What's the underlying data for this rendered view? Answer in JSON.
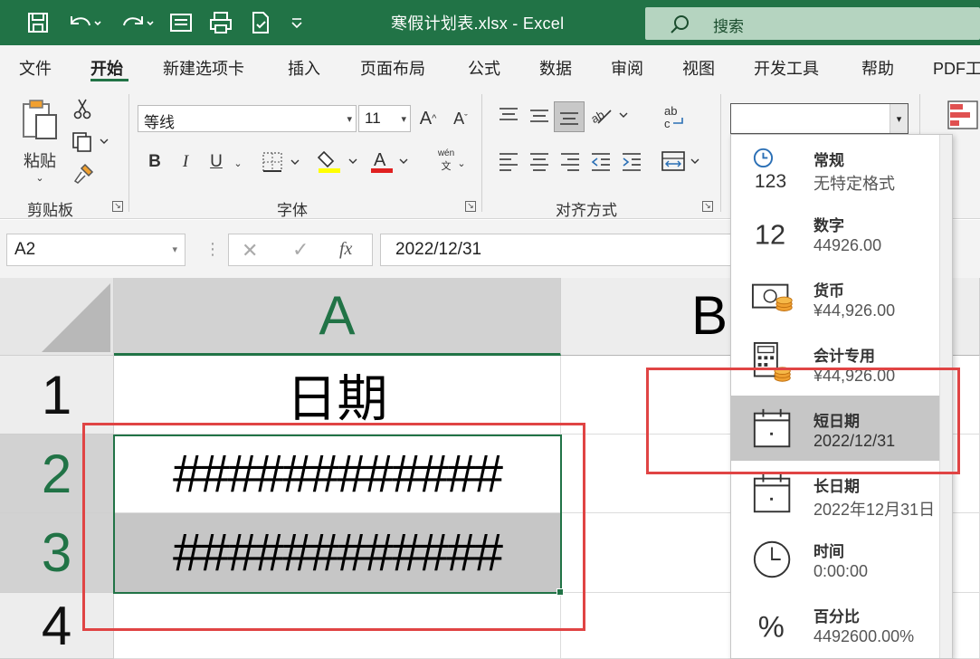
{
  "window": {
    "title": "寒假计划表.xlsx  -  Excel",
    "search_placeholder": "搜索"
  },
  "tabs": [
    "文件",
    "开始",
    "新建选项卡",
    "插入",
    "页面布局",
    "公式",
    "数据",
    "审阅",
    "视图",
    "开发工具",
    "帮助",
    "PDF工"
  ],
  "active_tab": "开始",
  "ribbon": {
    "paste_label": "粘贴",
    "groups": [
      "剪贴板",
      "字体",
      "对齐方式"
    ],
    "font_name": "等线",
    "font_size": "11",
    "bold": "B",
    "italic": "I",
    "underline": "U",
    "phonetic_top": "wén",
    "phonetic_bottom": "文",
    "number_format_value": ""
  },
  "formula_bar": {
    "name_box": "A2",
    "formula": "2022/12/31",
    "fx": "fx"
  },
  "sheet": {
    "columns": [
      "A",
      "B"
    ],
    "rows": [
      {
        "num": "1",
        "a": "日期"
      },
      {
        "num": "2",
        "a": "############"
      },
      {
        "num": "3",
        "a": "############"
      },
      {
        "num": "4",
        "a": ""
      }
    ]
  },
  "number_formats": [
    {
      "name": "常规",
      "sample": "无特定格式",
      "icon": "general-clock-123-icon"
    },
    {
      "name": "数字",
      "sample": "44926.00",
      "icon": "number-12-icon"
    },
    {
      "name": "货币",
      "sample": "¥44,926.00",
      "icon": "currency-icon"
    },
    {
      "name": "会计专用",
      "sample": " ¥44,926.00",
      "icon": "accounting-icon"
    },
    {
      "name": "短日期",
      "sample": "2022/12/31",
      "icon": "calendar-icon"
    },
    {
      "name": "长日期",
      "sample": "2022年12月31日",
      "icon": "calendar-icon"
    },
    {
      "name": "时间",
      "sample": "0:00:00",
      "icon": "clock-icon"
    },
    {
      "name": "百分比",
      "sample": "4492600.00%",
      "icon": "percent-icon"
    }
  ],
  "selected_format": "短日期",
  "colors": {
    "excel_green": "#217346",
    "highlight_red": "#e04444",
    "font_color_red": "#e02020",
    "fill_yellow": "#ffff00"
  }
}
